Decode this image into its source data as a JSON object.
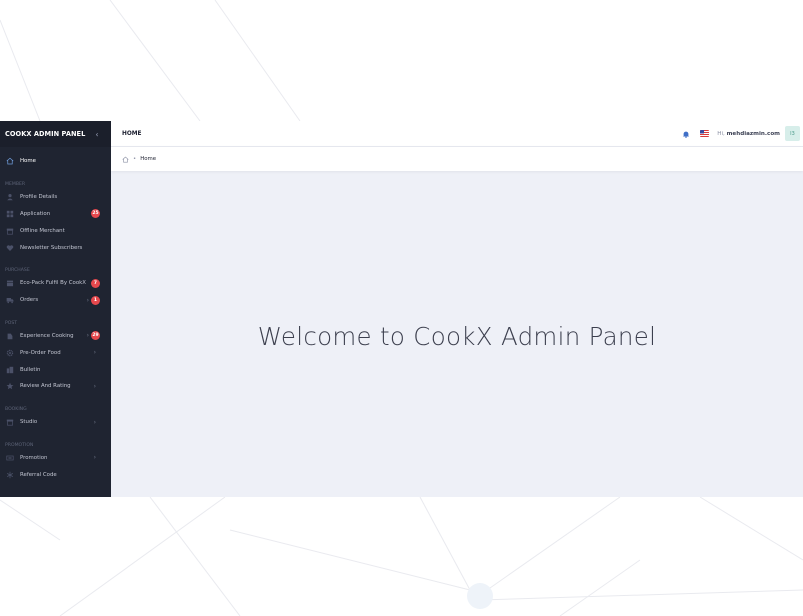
{
  "brand": {
    "title": "COOKX ADMIN PANEL",
    "collapse_icon": "chevron-left-icon"
  },
  "sidebar": {
    "home": {
      "label": "Home",
      "icon": "home-icon"
    },
    "sections": [
      {
        "title": "MEMBER",
        "items": [
          {
            "label": "Profile Details",
            "icon": "user-icon"
          },
          {
            "label": "Application",
            "icon": "grid-icon",
            "badge": "25"
          },
          {
            "label": "Offline Merchant",
            "icon": "store-icon"
          },
          {
            "label": "Newsletter Subscribers",
            "icon": "heart-icon"
          }
        ]
      },
      {
        "title": "PURCHASE",
        "items": [
          {
            "label": "Eco-Pack Fulfil By CookX",
            "icon": "box-icon",
            "badge": "7"
          },
          {
            "label": "Orders",
            "icon": "truck-icon",
            "badge": "1"
          }
        ]
      },
      {
        "title": "POST",
        "items": [
          {
            "label": "Experience Cooking",
            "icon": "chef-icon",
            "badge": "29"
          },
          {
            "label": "Pre-Order Food",
            "icon": "gear-icon"
          },
          {
            "label": "Bulletin",
            "icon": "building-icon"
          },
          {
            "label": "Review And Rating",
            "icon": "star-icon"
          }
        ]
      },
      {
        "title": "BOOKING",
        "items": [
          {
            "label": "Studio",
            "icon": "studio-icon"
          }
        ]
      },
      {
        "title": "PROMOTION",
        "items": [
          {
            "label": "Promotion",
            "icon": "ticket-icon"
          },
          {
            "label": "Referral Code",
            "icon": "asterisk-icon"
          }
        ]
      }
    ]
  },
  "topbar": {
    "page_title": "HOME",
    "greeting": "Hi,",
    "username": "mehdiazmin.com",
    "avatar_initial": "I3"
  },
  "breadcrumb": {
    "current": "Home",
    "separator": "•"
  },
  "main": {
    "welcome": "Welcome to CookX Admin Panel"
  },
  "colors": {
    "sidebar_bg": "#1f2431",
    "badge": "#e5484d",
    "content_bg": "#eef0f7"
  }
}
